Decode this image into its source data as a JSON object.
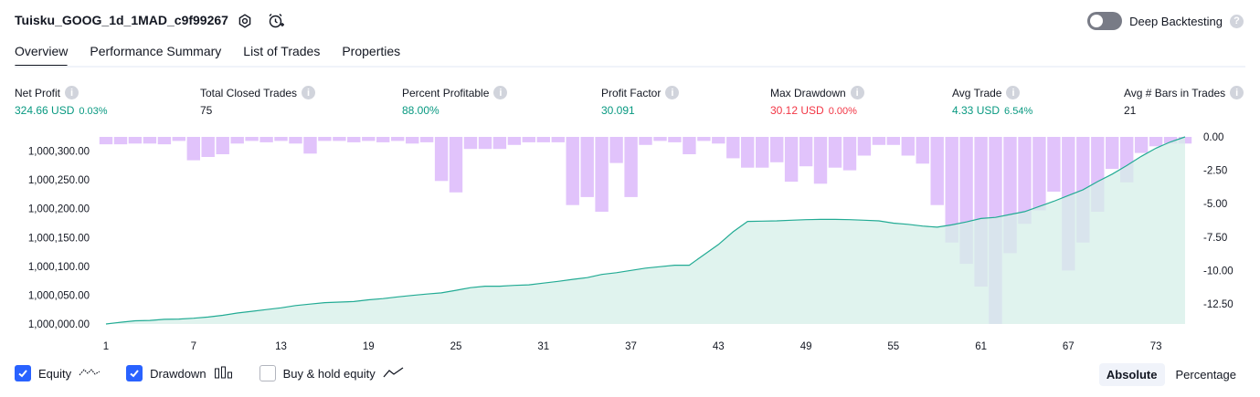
{
  "header": {
    "title": "Tuisku_GOOG_1d_1MAD_c9f99267",
    "deep_backtesting_label": "Deep Backtesting",
    "deep_backtesting_on": false
  },
  "tabs": [
    {
      "label": "Overview",
      "active": true
    },
    {
      "label": "Performance Summary",
      "active": false
    },
    {
      "label": "List of Trades",
      "active": false
    },
    {
      "label": "Properties",
      "active": false
    }
  ],
  "stats": [
    {
      "label": "Net Profit",
      "value": "324.66 USD",
      "sub": "0.03%",
      "color": "green"
    },
    {
      "label": "Total Closed Trades",
      "value": "75",
      "sub": "",
      "color": "dark"
    },
    {
      "label": "Percent Profitable",
      "value": "88.00%",
      "sub": "",
      "color": "green"
    },
    {
      "label": "Profit Factor",
      "value": "30.091",
      "sub": "",
      "color": "green"
    },
    {
      "label": "Max Drawdown",
      "value": "30.12 USD",
      "sub": "0.00%",
      "color": "red"
    },
    {
      "label": "Avg Trade",
      "value": "4.33 USD",
      "sub": "6.54%",
      "color": "green"
    },
    {
      "label": "Avg # Bars in Trades",
      "value": "21",
      "sub": "",
      "color": "dark"
    }
  ],
  "legend": {
    "equity_label": "Equity",
    "equity_checked": true,
    "drawdown_label": "Drawdown",
    "drawdown_checked": true,
    "buyhold_label": "Buy & hold equity",
    "buyhold_checked": false
  },
  "mode": {
    "absolute_label": "Absolute",
    "percentage_label": "Percentage",
    "active": "absolute"
  },
  "colors": {
    "equity_line": "#22ab94",
    "equity_fill": "#d6efe8",
    "drawdown_bar": "#e1c3fb",
    "checkbox": "#2962ff"
  },
  "chart_data": {
    "type": "area",
    "x_ticks": [
      "1",
      "7",
      "13",
      "19",
      "25",
      "31",
      "37",
      "43",
      "49",
      "55",
      "61",
      "67",
      "73"
    ],
    "left_axis": {
      "ticks": [
        "1,000,000.00",
        "1,000,050.00",
        "1,000,100.00",
        "1,000,150.00",
        "1,000,200.00",
        "1,000,250.00",
        "1,000,300.00"
      ],
      "ylim": [
        1000000,
        1000324.66
      ]
    },
    "right_axis": {
      "ticks": [
        "0.00",
        "-2.50",
        "-5.00",
        "-7.50",
        "-10.00",
        "-12.50"
      ],
      "ylim": [
        -14.0,
        0.0
      ]
    },
    "series": [
      {
        "name": "Equity",
        "axis": "left",
        "values": [
          1000000.0,
          1000003.0,
          1000005.5,
          1000006.2,
          1000008.0,
          1000008.6,
          1000010.0,
          1000012.0,
          1000015.0,
          1000019.0,
          1000022.0,
          1000025.0,
          1000028.0,
          1000032.0,
          1000034.5,
          1000037.0,
          1000038.0,
          1000039.0,
          1000042.0,
          1000044.0,
          1000047.0,
          1000049.5,
          1000052.0,
          1000054.0,
          1000058.5,
          1000063.0,
          1000065.5,
          1000065.5,
          1000067.0,
          1000068.0,
          1000071.0,
          1000074.0,
          1000077.5,
          1000080.5,
          1000086.0,
          1000089.0,
          1000093.0,
          1000097.0,
          1000099.5,
          1000102.0,
          1000102.0,
          1000120.0,
          1000138.0,
          1000160.0,
          1000178.0,
          1000178.5,
          1000179.0,
          1000180.0,
          1000181.0,
          1000181.5,
          1000181.5,
          1000181.0,
          1000180.0,
          1000179.0,
          1000175.0,
          1000173.0,
          1000170.0,
          1000168.0,
          1000172.0,
          1000177.0,
          1000183.0,
          1000185.0,
          1000190.0,
          1000195.0,
          1000204.0,
          1000213.0,
          1000223.0,
          1000233.0,
          1000247.0,
          1000260.0,
          1000275.0,
          1000291.0,
          1000305.0,
          1000316.0,
          1000324.66
        ]
      },
      {
        "name": "Drawdown",
        "axis": "right",
        "values": [
          -0.55,
          -0.55,
          -0.5,
          -0.5,
          -0.55,
          -0.3,
          -1.75,
          -1.5,
          -1.3,
          -0.5,
          -0.3,
          -0.4,
          -0.3,
          -0.5,
          -1.25,
          -0.3,
          -0.3,
          -0.4,
          -0.3,
          -0.4,
          -0.3,
          -0.5,
          -0.4,
          -3.3,
          -4.15,
          -0.9,
          -0.9,
          -0.9,
          -0.6,
          -0.4,
          -0.4,
          -0.4,
          -5.1,
          -4.5,
          -5.6,
          -1.95,
          -4.5,
          -0.6,
          -0.3,
          -0.4,
          -1.3,
          -0.3,
          -0.5,
          -1.6,
          -2.3,
          -2.3,
          -1.9,
          -3.35,
          -2.2,
          -3.5,
          -2.3,
          -2.5,
          -1.4,
          -0.6,
          -0.6,
          -1.4,
          -2.0,
          -5.1,
          -7.9,
          -9.5,
          -11.2,
          -14.0,
          -8.7,
          -6.5,
          -5.5,
          -4.1,
          -10.0,
          -7.9,
          -5.6,
          -2.4,
          -3.4,
          -1.2,
          -0.7,
          -0.5,
          -0.5
        ]
      }
    ]
  }
}
